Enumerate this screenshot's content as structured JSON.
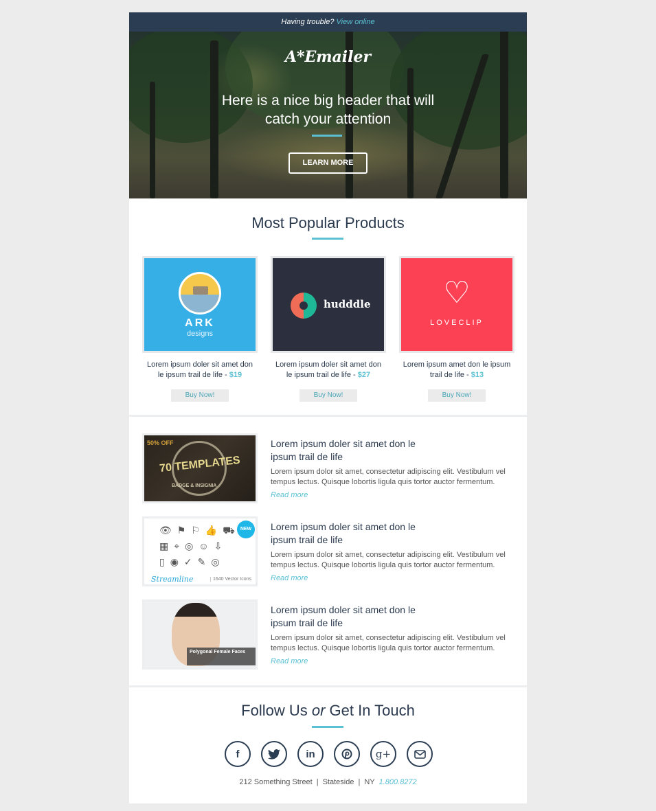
{
  "topbar": {
    "prefix": "Having trouble?",
    "link": "View online"
  },
  "hero": {
    "logo": "A*Emailer",
    "headline_line1": "Here is a nice big header that will",
    "headline_line2": "catch your attention",
    "cta": "LEARN MORE"
  },
  "products": {
    "title": "Most Popular Products",
    "items": [
      {
        "brand": "ARK",
        "brand_sub": "designs",
        "desc": "Lorem ipsum doler sit amet don le ipsum trail de life - ",
        "price": "$19",
        "button": "Buy Now!",
        "bg": "#36aee6"
      },
      {
        "brand": "hudddle",
        "brand_sub": "",
        "desc": "Lorem ipsum doler sit amet don le ipsum trail de life - ",
        "price": "$27",
        "button": "Buy Now!",
        "bg": "#2c2f3e"
      },
      {
        "brand": "LOVECLIP",
        "brand_sub": "",
        "desc": "Lorem ipsum amet don le ipsum trail de life - ",
        "price": "$13",
        "button": "Buy Now!",
        "bg": "#fd4155"
      }
    ]
  },
  "articles": [
    {
      "image_caption": "70 TEMPLATES",
      "image_badge": "50% OFF",
      "image_sub": "BADGE & INSIGNIA",
      "title": "Lorem ipsum doler sit amet don le ipsum trail de life",
      "body": "Lorem ipsum dolor sit amet, consectetur adipiscing elit. Vestibulum vel tempus lectus. Quisque lobortis ligula quis tortor auctor fermentum.",
      "link": "Read more"
    },
    {
      "image_caption": "Streamline",
      "image_badge": "NEW",
      "image_sub": "1640 Vector Icons",
      "title": "Lorem ipsum doler sit amet don le ipsum trail de life",
      "body": "Lorem ipsum dolor sit amet, consectetur adipiscing elit. Vestibulum vel tempus lectus. Quisque lobortis ligula quis tortor auctor fermentum.",
      "link": "Read more"
    },
    {
      "image_caption": "Polygonal Female Faces",
      "image_badge": "",
      "image_sub": "",
      "title": "Lorem ipsum doler sit amet don le ipsum trail de life",
      "body": "Lorem ipsum dolor sit amet, consectetur adipiscing elit. Vestibulum vel tempus lectus. Quisque lobortis ligula quis tortor auctor fermentum.",
      "link": "Read more"
    }
  ],
  "footer": {
    "title_a": "Follow Us ",
    "title_or": "or",
    "title_b": " Get In Touch",
    "socials": [
      {
        "name": "facebook-icon",
        "glyph": "f"
      },
      {
        "name": "twitter-icon",
        "glyph": "🐦"
      },
      {
        "name": "linkedin-icon",
        "glyph": "in"
      },
      {
        "name": "pinterest-icon",
        "glyph": "℗"
      },
      {
        "name": "google-plus-icon",
        "glyph": "g+"
      },
      {
        "name": "email-icon",
        "glyph": "✉"
      }
    ],
    "street": "212 Something Street",
    "city": "Stateside",
    "state": "NY",
    "phone": "1.800.8272",
    "separator": "|"
  },
  "colors": {
    "accent": "#5bc0d3",
    "navy": "#2b3d52",
    "page_bg": "#ececec"
  }
}
